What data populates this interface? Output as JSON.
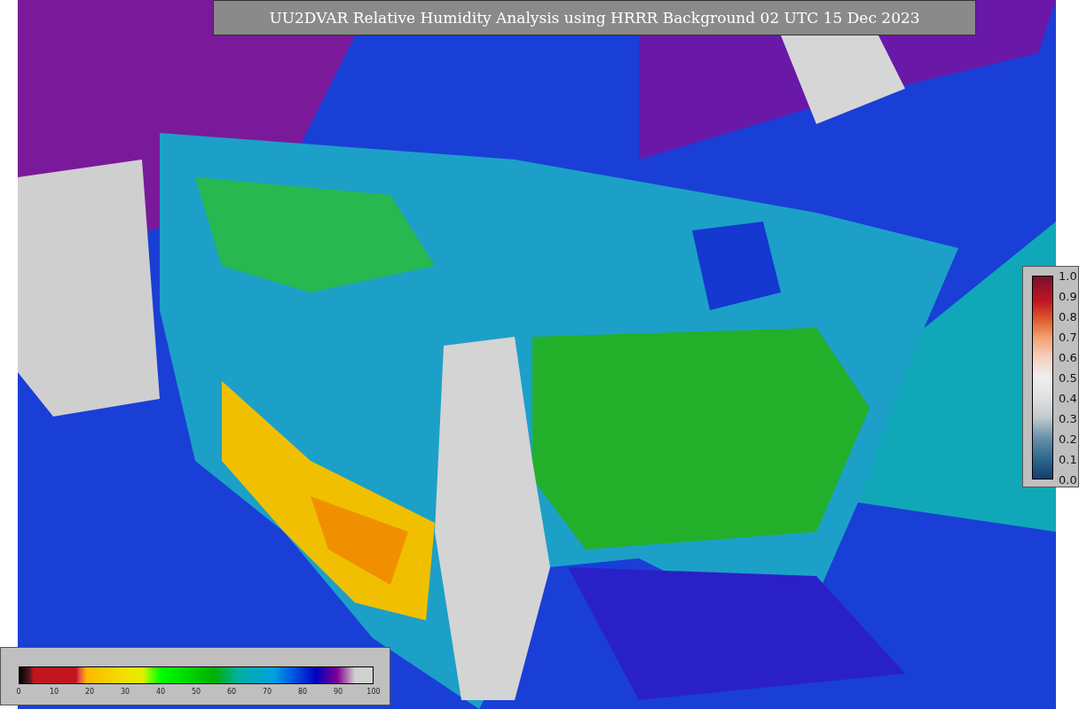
{
  "title": "UU2DVAR Relative Humidity Analysis using HRRR Background 02 UTC 15 Dec 2023",
  "humidity_colorbar": {
    "ticks": [
      "0",
      "10",
      "20",
      "30",
      "40",
      "50",
      "60",
      "70",
      "80",
      "90",
      "100"
    ]
  },
  "value_colorbar": {
    "ticks": [
      "1.0",
      "0.9",
      "0.8",
      "0.7",
      "0.6",
      "0.5",
      "0.4",
      "0.3",
      "0.2",
      "0.1",
      "0.0"
    ]
  }
}
